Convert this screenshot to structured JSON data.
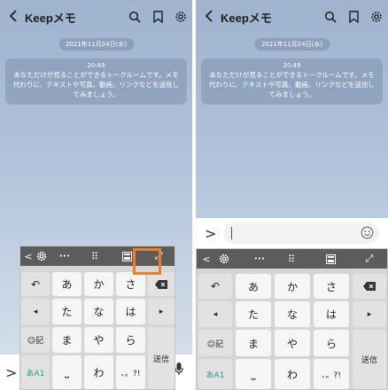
{
  "header": {
    "title": "Keepメモ",
    "back_icon": "chevron-left-icon"
  },
  "chat": {
    "date": "2021年11月24日(水)",
    "system_message": {
      "time": "20:49",
      "line1": "あなただけが見ることができるトークルームです。メモ",
      "line2": "代わりに、テキストや写真、動画、リンクなどを送信し",
      "line3": "てみましょう。"
    }
  },
  "keyboard": {
    "toolbar": {
      "back": "<",
      "dots": "•••",
      "grid": "⠿",
      "expand": "⤢"
    },
    "rows": {
      "r1": {
        "undo": "↶",
        "k1": "あ",
        "k2": "か",
        "k3": "さ"
      },
      "r2": {
        "left": "◂",
        "k1": "た",
        "k2": "な",
        "k3": "は",
        "right": "▸"
      },
      "r3": {
        "emoji": "☺記",
        "k1": "ま",
        "k2": "や",
        "k3": "ら"
      },
      "r4": {
        "mode": "あA1",
        "space": "⎵",
        "k2": "わ",
        "punct": "、。?!"
      },
      "send": "送信"
    }
  },
  "bottombar": {
    "chevron": ">",
    "mic_icon": "microphone-icon"
  },
  "accent_color": "#f07d21"
}
